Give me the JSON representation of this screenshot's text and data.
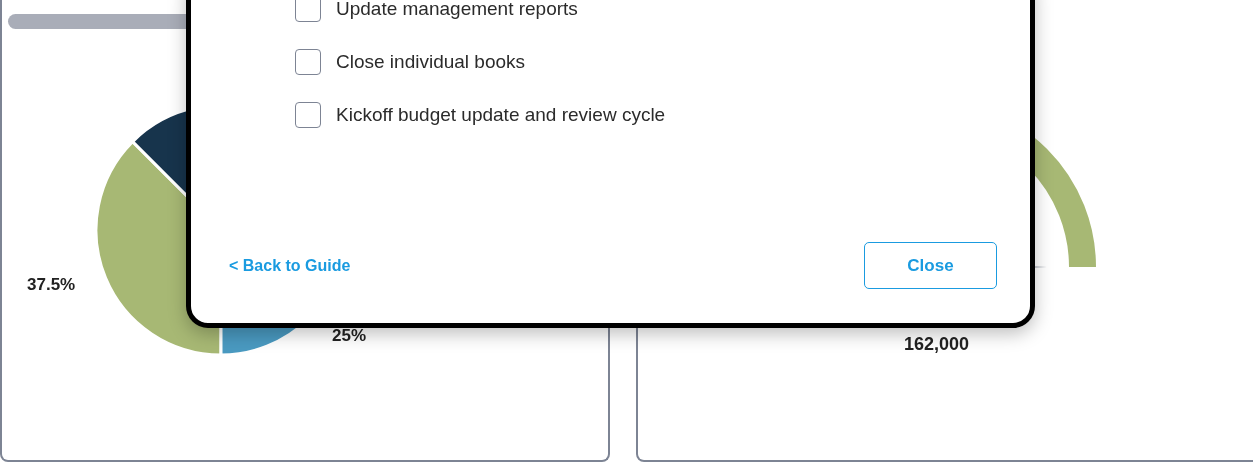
{
  "dashboard": {
    "pie_labels": [
      "37.5%",
      "25%"
    ],
    "gauge_value": "162,000"
  },
  "dialog": {
    "tasks": [
      {
        "label": "Update management reports",
        "checked": false
      },
      {
        "label": "Close individual books",
        "checked": false
      },
      {
        "label": "Kickoff budget update and review cycle",
        "checked": false
      }
    ],
    "back_link": "< Back to Guide",
    "close_button": "Close"
  }
}
